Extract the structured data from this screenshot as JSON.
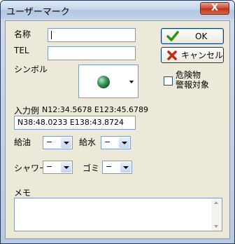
{
  "window": {
    "title": "ユーザーマーク",
    "close_label": "X"
  },
  "form": {
    "name_label": "名称",
    "name_value": "",
    "tel_label": "TEL",
    "tel_value": "",
    "symbol_label": "シンボル",
    "example_label": "入力例",
    "example_value": "N12:34.5678 E123:45.6789",
    "coords_value": "N38:48.0233 E138:43.8724",
    "fuel_label": "給油",
    "fuel_value": "−",
    "water_label": "給水",
    "water_value": "−",
    "shower_label": "シャワー",
    "shower_value": "−",
    "trash_label": "ゴミ",
    "trash_value": "−",
    "memo_label": "メモ",
    "memo_value": ""
  },
  "buttons": {
    "ok_label": "OK",
    "cancel_label": "キャンセル"
  },
  "hazard": {
    "line1": "危険物",
    "line2": "警報対象",
    "checked": false
  },
  "colors": {
    "ok_check": "#2f8f1f",
    "cancel_x": "#c0281a",
    "symbol_ball": "#3a9a5c"
  }
}
